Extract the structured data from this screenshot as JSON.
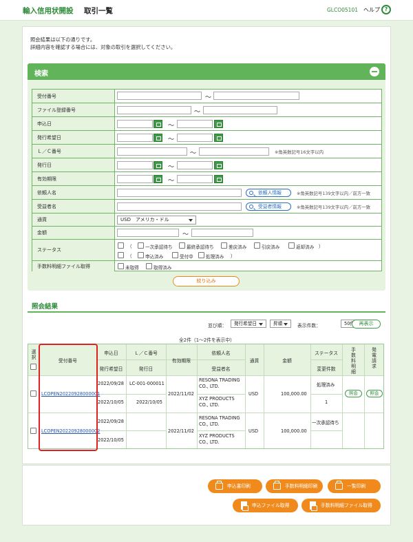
{
  "header": {
    "title": "輸入信用状開設",
    "subtitle": "取引一覧",
    "screen_id": "GLCO05101",
    "help_label": "ヘルプ",
    "help_icon": "?"
  },
  "intro": {
    "line1": "照会結果は以下の通りです。",
    "line2": "詳細内容を確認する場合には、対象の取引を選択してください。"
  },
  "search": {
    "title": "検索",
    "labels": {
      "receipt_no": "受付番号",
      "file_reg_no": "ファイル登録番号",
      "apply_date": "申込日",
      "issue_req_date": "発行希望日",
      "lc_no": "Ｌ／Ｃ番号",
      "issue_date": "発行日",
      "expiry": "有効期限",
      "applicant": "依頼人名",
      "beneficiary": "受益者名",
      "currency": "通貨",
      "amount": "金額",
      "status": "ステータス",
      "fee_file": "手数料明細ファイル取得"
    },
    "tilde": "～",
    "lc_note": "※角英数記号16文字以内",
    "applicant_button": "依頼人情報",
    "applicant_note": "※角英数記号139文字以内／前方一致",
    "beneficiary_button": "受益者情報",
    "beneficiary_note": "※角英数記号139文字以内／前方一致",
    "currency_value": "USD　アメリカ・ドル",
    "status_open": "（",
    "status_close": "）",
    "status_row1": [
      "一次承認待ち",
      "最終承認待ち",
      "差戻済み",
      "引戻済み",
      "返却済み"
    ],
    "status_row2": [
      "申込済み",
      "受付中",
      "処理済み"
    ],
    "fee_options": [
      "未取得",
      "取得済み"
    ],
    "filter_button": "絞り込み"
  },
  "results": {
    "title": "照会結果",
    "sort_label": "並び順：",
    "sort_value": "発行希望日",
    "order_value": "昇順",
    "display_label": "表示件数：",
    "display_value": "50件",
    "redisplay_button": "再表示",
    "count_text": "全2件（1～2件を表示中）",
    "headers": {
      "select": "選択",
      "receipt_no": "受付番号",
      "apply_date": "申込日",
      "issue_req_date": "発行希望日",
      "lc_no": "Ｌ／Ｃ番号",
      "issue_date": "発行日",
      "expiry": "有効期限",
      "applicant": "依頼人名",
      "beneficiary": "受益者名",
      "currency": "通貨",
      "amount": "金額",
      "status": "ステータス",
      "changes": "変更件数",
      "fee": "手数料明細",
      "notice": "発電請求"
    },
    "rows": [
      {
        "receipt_no": "LCOPEN20220928000001",
        "apply_date": "2022/09/28",
        "issue_req_date": "2022/10/05",
        "lc_no": "LC-001-000011",
        "issue_date": "2022/10/05",
        "expiry": "2022/11/02",
        "applicant": "RESONA TRADING CO., LTD.",
        "beneficiary": "XYZ PRODUCTS CO., LTD.",
        "currency": "USD",
        "amount": "100,000.00",
        "status": "処理済み",
        "changes": "1",
        "fee_button": "照会",
        "notice_button": "照会"
      },
      {
        "receipt_no": "LCOPEN20220928000002",
        "apply_date": "2022/09/28",
        "issue_req_date": "2022/10/05",
        "lc_no": "",
        "issue_date": "",
        "expiry": "2022/11/02",
        "applicant": "RESONA TRADING CO., LTD.",
        "beneficiary": "XYZ PRODUCTS CO., LTD.",
        "currency": "USD",
        "amount": "100,000.00",
        "status": "一次承認待ち",
        "changes": ""
      }
    ]
  },
  "footer": {
    "print_application": "申込書印刷",
    "print_fee": "手数料明細印刷",
    "print_list": "一覧印刷",
    "get_app_file": "申込ファイル取得",
    "get_fee_file": "手数料明細ファイル取得"
  },
  "colors": {
    "accent": "#62b45a",
    "brand_text": "#2e8b3a",
    "orange": "#f08a1c",
    "highlight": "#e02020"
  }
}
